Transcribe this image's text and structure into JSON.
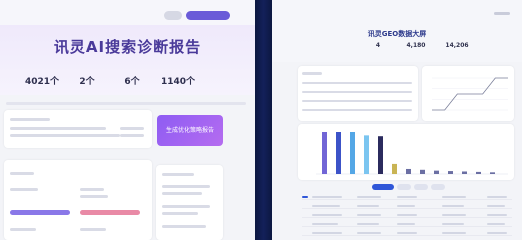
{
  "left": {
    "title": "讯灵AI搜索诊断报告",
    "stats": [
      {
        "label": "",
        "value": "4021个"
      },
      {
        "label": "",
        "value": "2个"
      },
      {
        "label": "",
        "value": "6个"
      },
      {
        "label": "",
        "value": "1140个"
      }
    ],
    "cta_label": "生成优化策略报告",
    "bars": [
      {
        "color": "#8a78e8",
        "fraction": 1.0
      },
      {
        "color": "#e98aa6",
        "fraction": 1.0
      }
    ]
  },
  "right": {
    "title": "讯灵GEO数据大屏",
    "stats": [
      {
        "label": "",
        "value": "4"
      },
      {
        "label": "",
        "value": "4,180"
      },
      {
        "label": "",
        "value": "14,206"
      }
    ],
    "chart_data": [
      {
        "type": "bar",
        "categories": [
          "",
          "",
          "",
          "",
          "",
          "",
          "",
          "",
          "",
          "",
          "",
          "",
          ""
        ],
        "values": [
          100,
          100,
          100,
          92,
          90,
          24,
          12,
          10,
          8,
          7,
          6,
          5,
          4
        ],
        "colors": [
          "#7165d6",
          "#3c53c8",
          "#54a7e6",
          "#7bc5f0",
          "#2b2b5e",
          "#c9b454",
          "#6b6fa3",
          "#6b6fa3",
          "#6b6fa3",
          "#6b6fa3",
          "#6b6fa3",
          "#6b6fa3",
          "#6b6fa3"
        ]
      },
      {
        "type": "line",
        "x": [
          0,
          1,
          2,
          3,
          4,
          5,
          6
        ],
        "values": [
          1,
          1,
          2,
          2,
          2,
          3,
          3
        ]
      }
    ]
  }
}
